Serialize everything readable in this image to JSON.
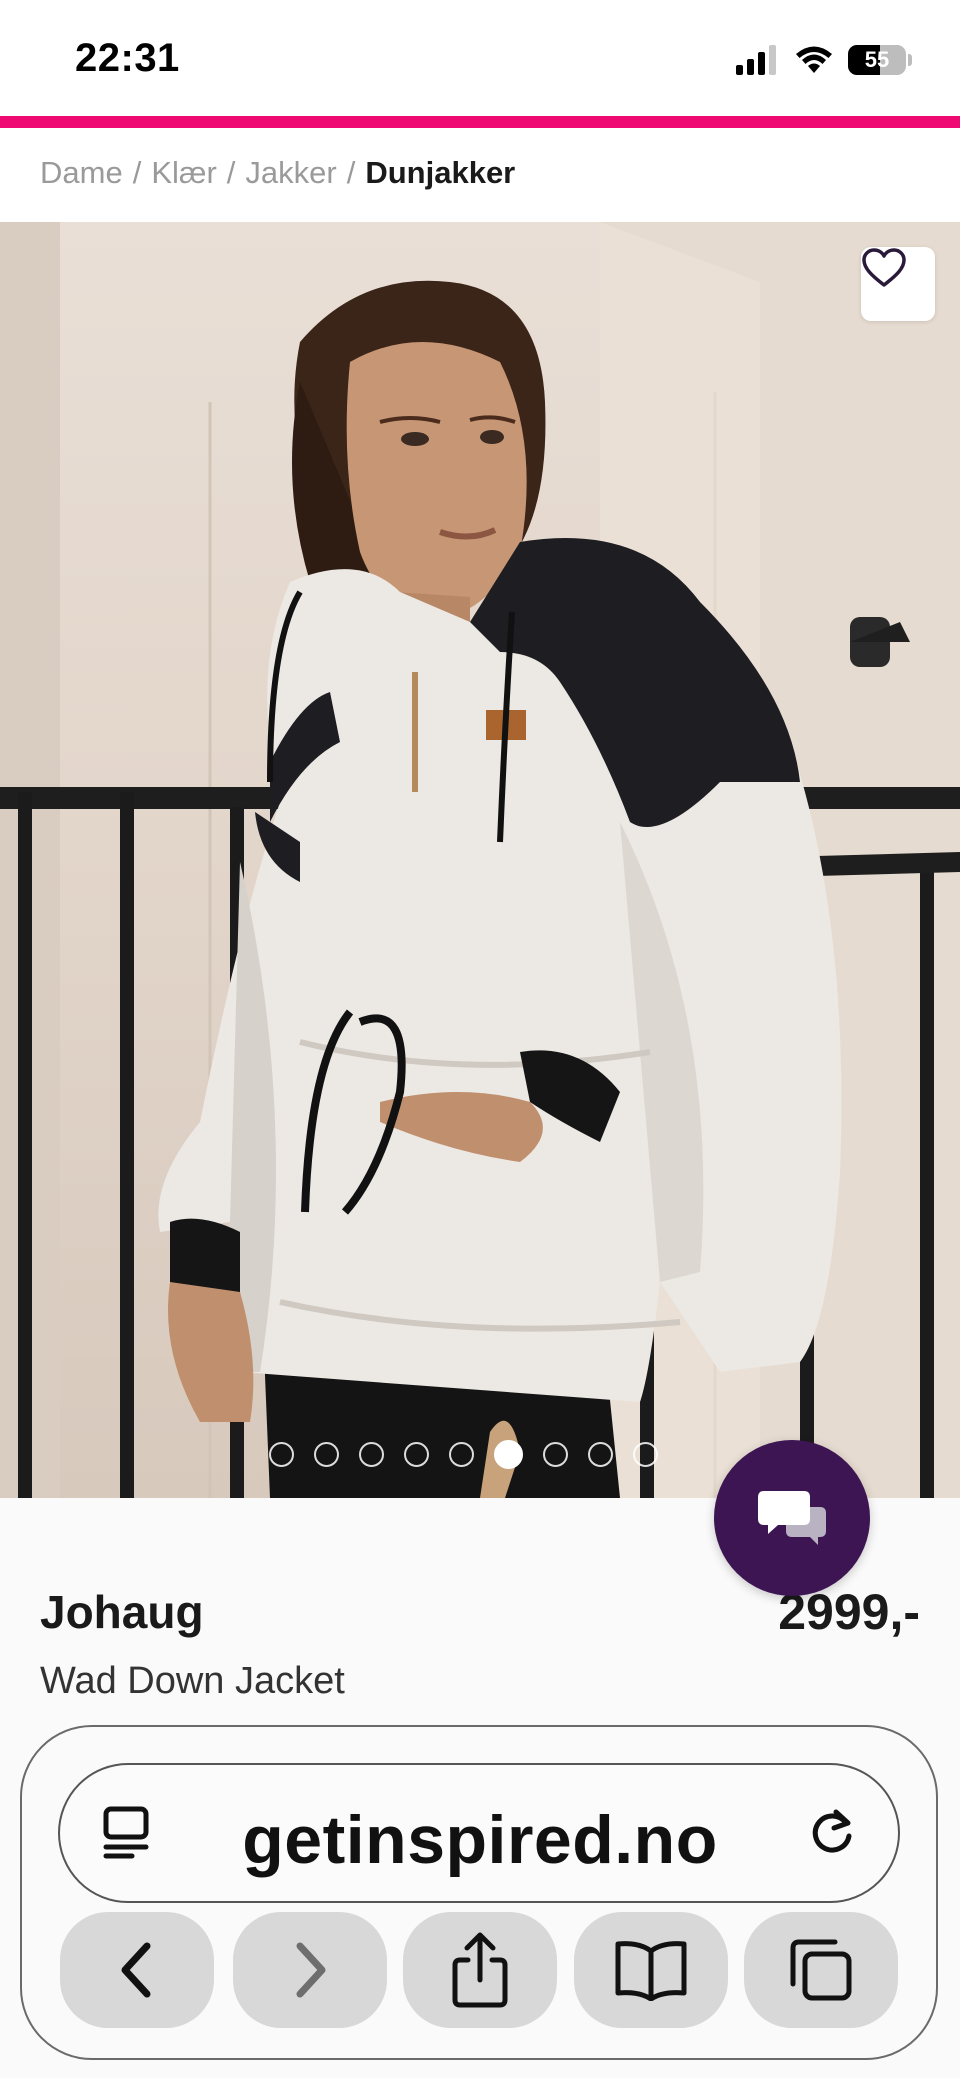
{
  "status_bar": {
    "time": "22:31",
    "battery": "55",
    "battery_level": 0.55
  },
  "breadcrumb": {
    "items": [
      "Dame",
      "Klær",
      "Jakker"
    ],
    "separator": "/",
    "current": "Dunjakker"
  },
  "gallery": {
    "slide_count": 9,
    "active_index": 5
  },
  "product": {
    "brand": "Johaug",
    "name": "Wad Down Jacket",
    "price": "2999,-"
  },
  "browser": {
    "url": "getinspired.no"
  },
  "icons": {
    "favorite": "heart-icon",
    "chat": "chat-bubbles-icon",
    "reader": "reader-mode-icon",
    "reload": "reload-icon",
    "back": "back-chevron-icon",
    "forward": "forward-chevron-icon",
    "share": "share-icon",
    "bookmarks": "book-icon",
    "tabs": "tabs-icon"
  },
  "colors": {
    "accent": "#ef0a73",
    "chat": "#3c1552"
  }
}
